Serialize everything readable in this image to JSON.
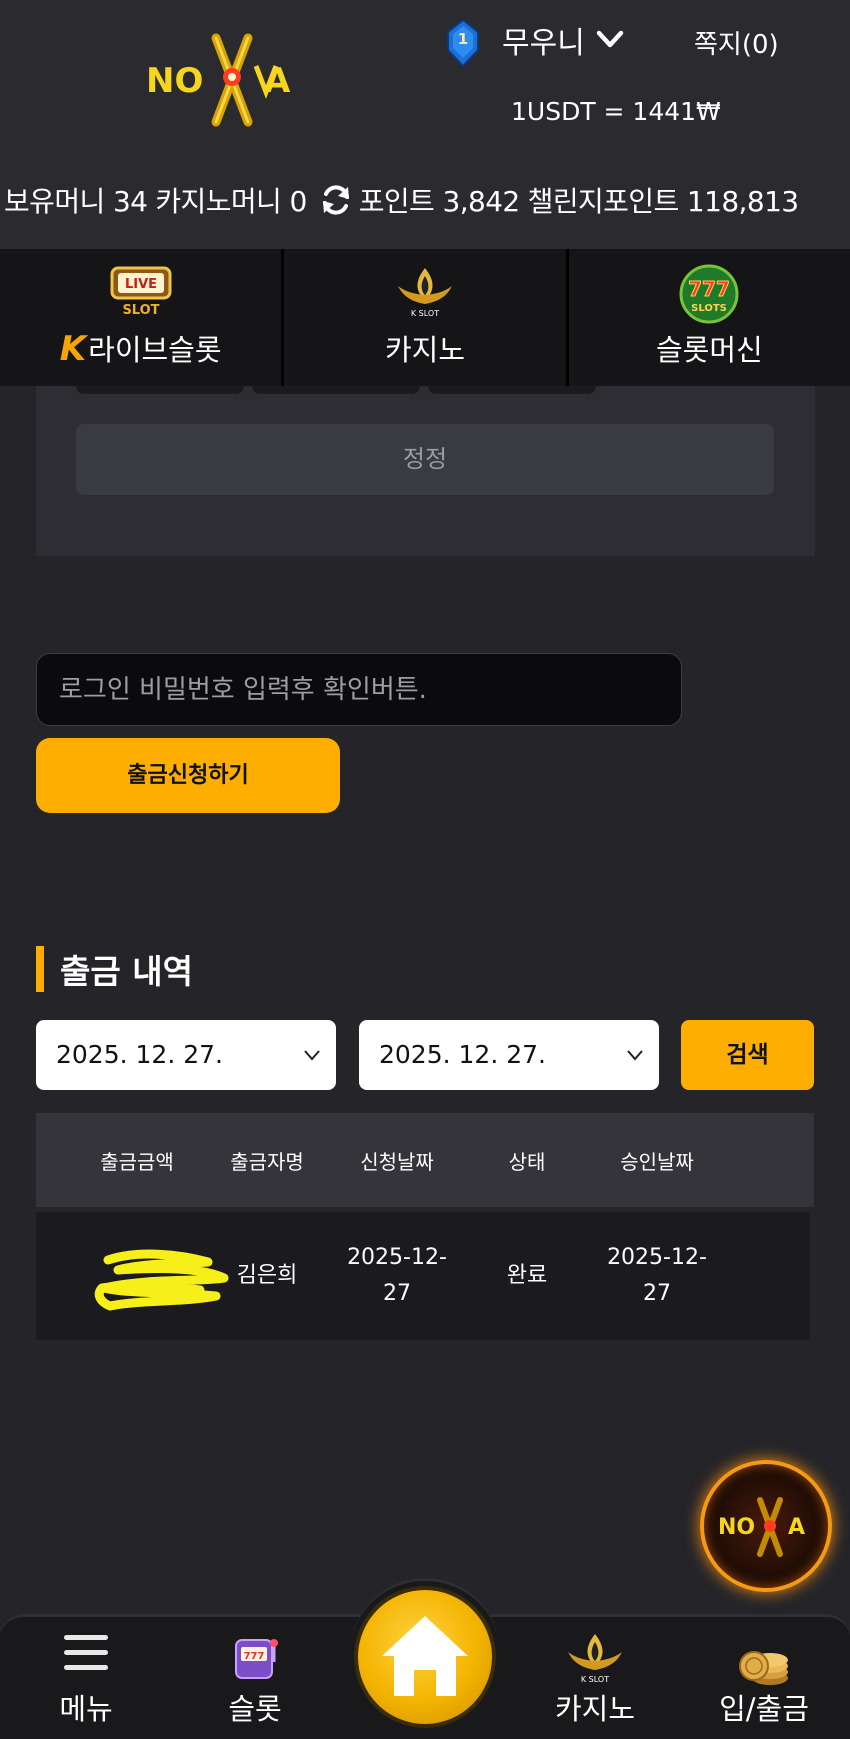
{
  "header": {
    "brand_logo_text": "NOVA",
    "level": "1",
    "username": "무우니",
    "messages_label": "쪽지(0)",
    "exchange_rate": "1USDT = 1441₩"
  },
  "balances": {
    "holding_money": "보유머니 34",
    "casino_money": "카지노머니 0",
    "points": "포인트 3,842",
    "challenge_points": "챌린지포인트 118,813"
  },
  "categories": [
    {
      "label": "라이브슬롯",
      "brand_mark": "K",
      "icon_text": "LIVE SLOT",
      "icon": "live-slot-icon"
    },
    {
      "label": "카지노",
      "icon_text": "K SLOT",
      "icon": "k-slot-icon"
    },
    {
      "label": "슬롯머신",
      "icon_text": "777 SLOTS",
      "icon": "slots-777-icon"
    }
  ],
  "panel": {
    "correct_button": "정정"
  },
  "withdraw": {
    "password_placeholder": "로그인 비밀번호 입력후 확인버튼.",
    "submit_label": "출금신청하기"
  },
  "history": {
    "title": "출금 내역",
    "date_from": "2025. 12. 27.",
    "date_to": "2025. 12. 27.",
    "search_label": "검색",
    "columns": [
      "출금금액",
      "출금자명",
      "신청날짜",
      "상태",
      "승인날짜"
    ],
    "rows": [
      {
        "amount": "",
        "name": "김은희",
        "request_date_1": "2025-12-",
        "request_date_2": "27",
        "status": "완료",
        "approve_date_1": "2025-12-",
        "approve_date_2": "27"
      }
    ]
  },
  "bottom_nav": {
    "menu": "메뉴",
    "slot": "슬롯",
    "casino": "카지노",
    "deposit_withdraw": "입/출금"
  },
  "colors": {
    "accent": "#fdae00",
    "background": "#242429",
    "header_bg": "#2a2a2f"
  }
}
